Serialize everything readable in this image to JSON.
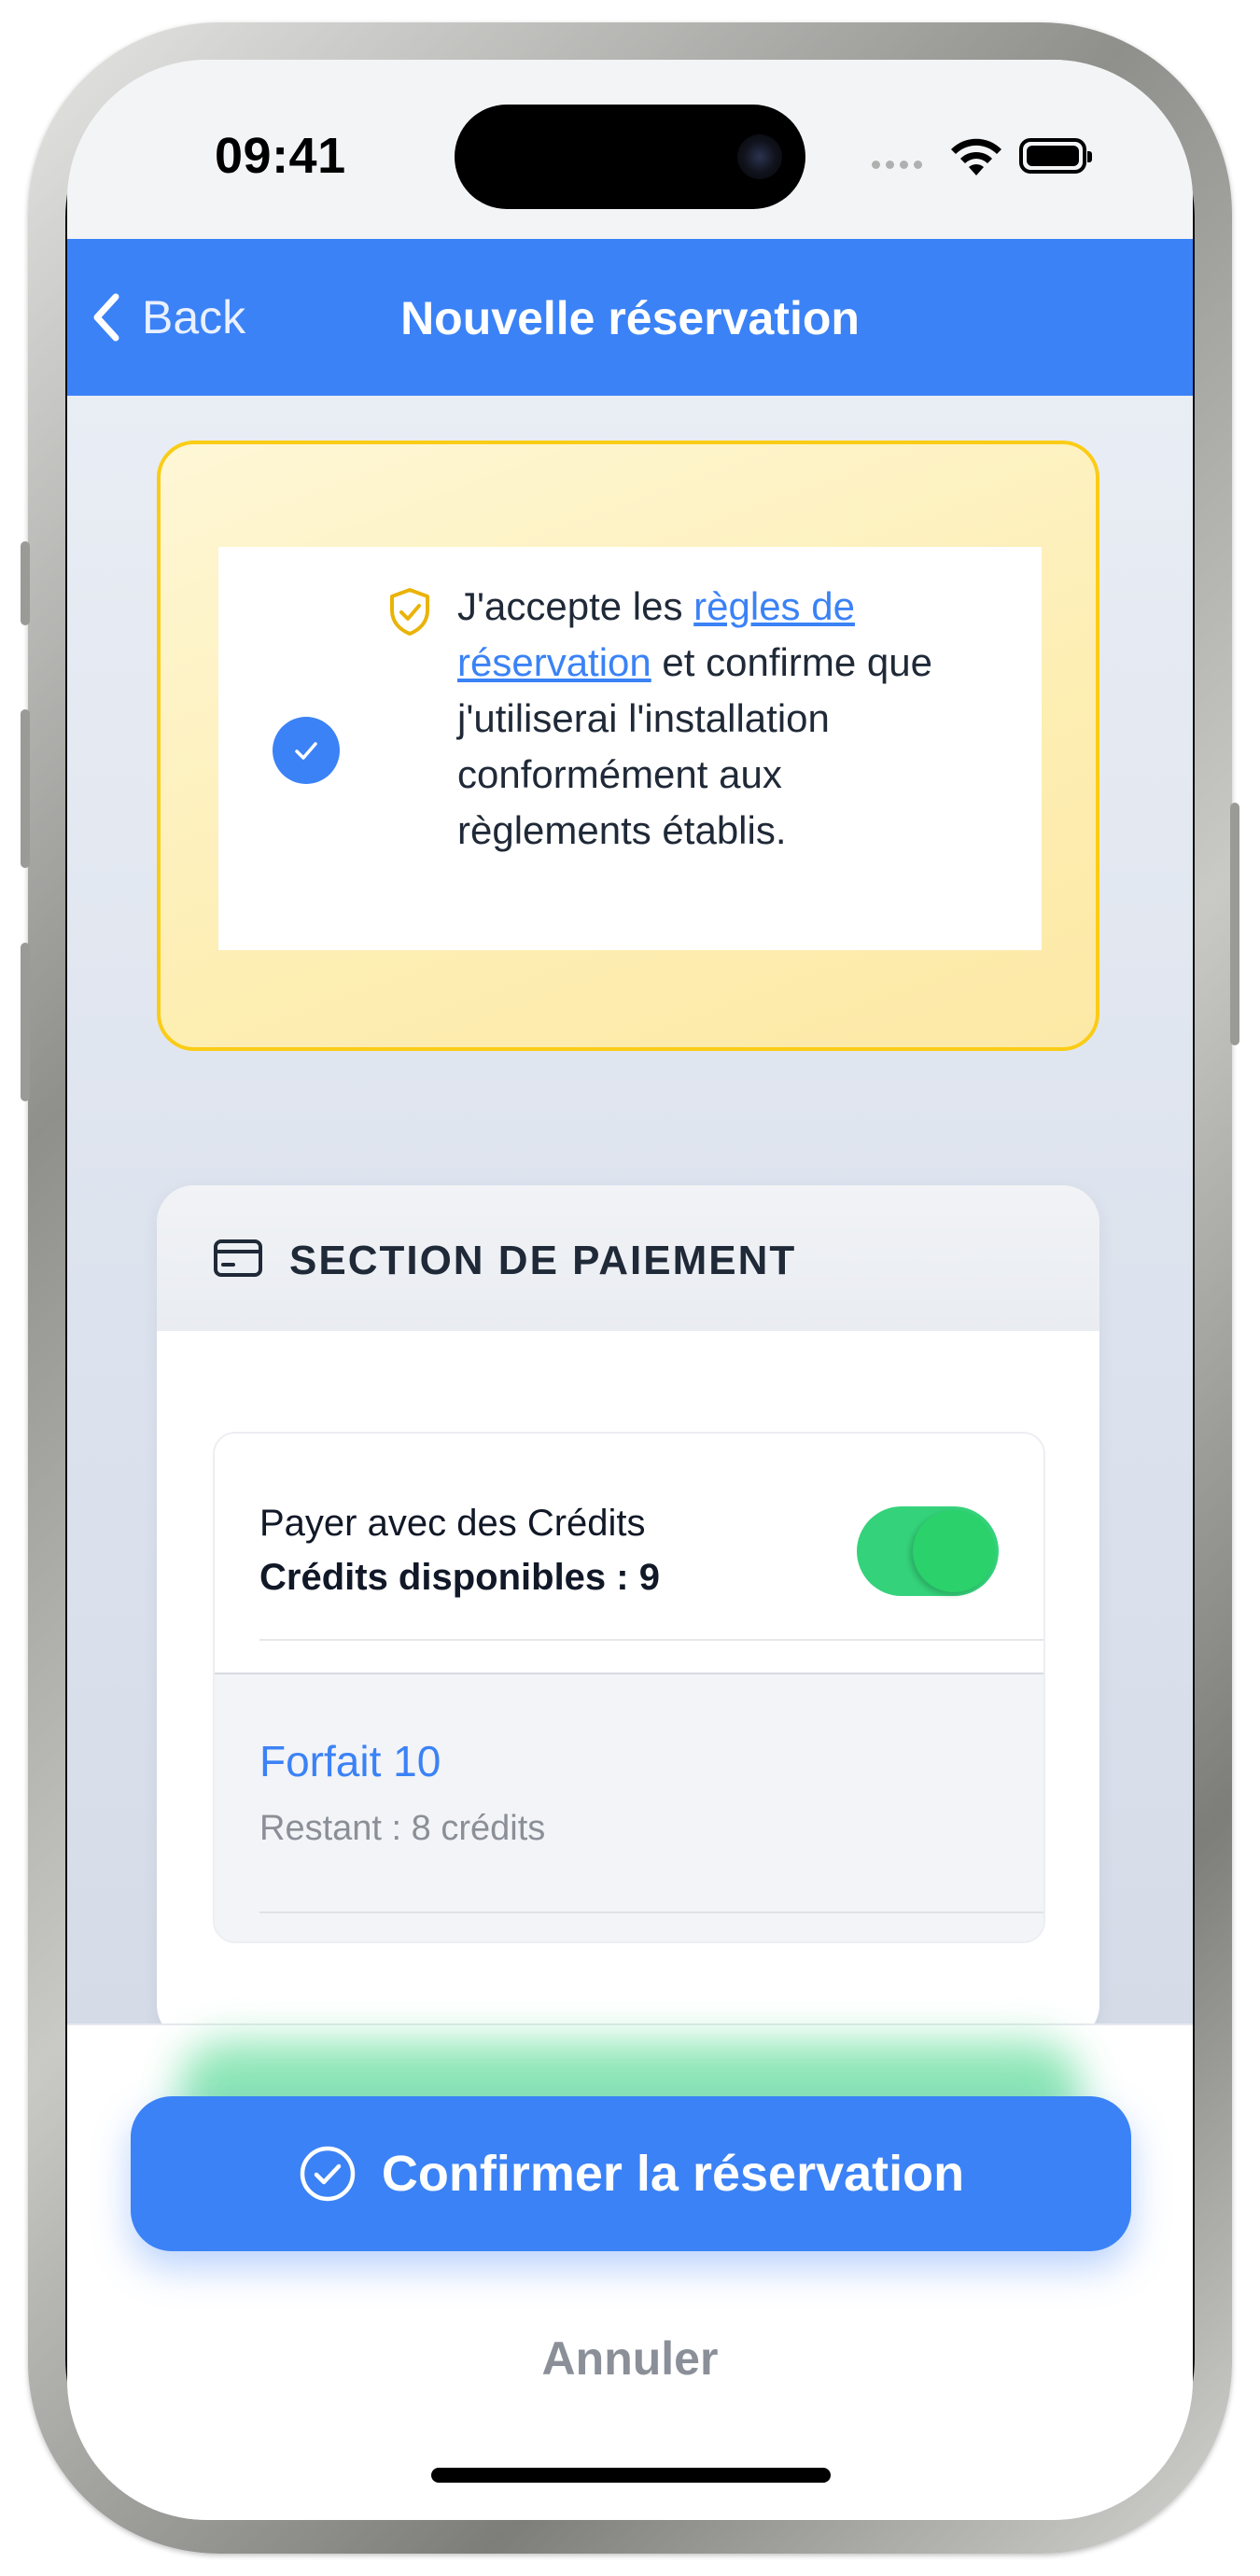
{
  "status_bar": {
    "time": "09:41"
  },
  "nav": {
    "back_label": "Back",
    "title": "Nouvelle réservation"
  },
  "consent": {
    "checked": true,
    "text_before": "J'accepte les ",
    "link_text": "règles de réservation",
    "text_after": " et confirme que j'utiliserai l'installation conformément aux règlements établis."
  },
  "payment": {
    "title": "SECTION DE PAIEMENT",
    "pay_with_credits_label": "Payer avec des Crédits",
    "available_credits_label": "Crédits disponibles : 9",
    "pay_with_credits_enabled": true,
    "package_name": "Forfait 10",
    "package_remaining": "Restant : 8 crédits"
  },
  "actions": {
    "confirm_label": "Confirmer la réservation",
    "cancel_label": "Annuler"
  },
  "colors": {
    "accent": "#3b82f6",
    "warning_border": "#facc15",
    "toggle_on": "#34d27a"
  },
  "icons": [
    "chevron-left-icon",
    "shield-check-icon",
    "check-icon",
    "credit-card-icon",
    "check-circle-icon"
  ]
}
